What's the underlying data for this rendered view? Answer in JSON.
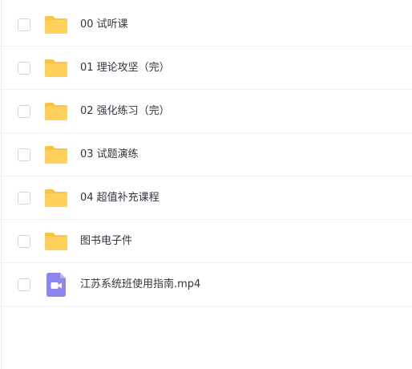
{
  "colors": {
    "folder": "#ffd15c",
    "folder_tab": "#f7c543",
    "video": "#8e86f0",
    "text": "#333640"
  },
  "files": [
    {
      "name": "00 试听课",
      "type": "folder",
      "icon": "folder-icon"
    },
    {
      "name": "01 理论攻坚（完）",
      "type": "folder",
      "icon": "folder-icon"
    },
    {
      "name": "02 强化练习（完）",
      "type": "folder",
      "icon": "folder-icon"
    },
    {
      "name": "03 试题演练",
      "type": "folder",
      "icon": "folder-icon"
    },
    {
      "name": "04 超值补充课程",
      "type": "folder",
      "icon": "folder-icon"
    },
    {
      "name": "图书电子件",
      "type": "folder",
      "icon": "folder-icon"
    },
    {
      "name": "江苏系统班使用指南.mp4",
      "type": "video",
      "icon": "video-file-icon"
    }
  ]
}
